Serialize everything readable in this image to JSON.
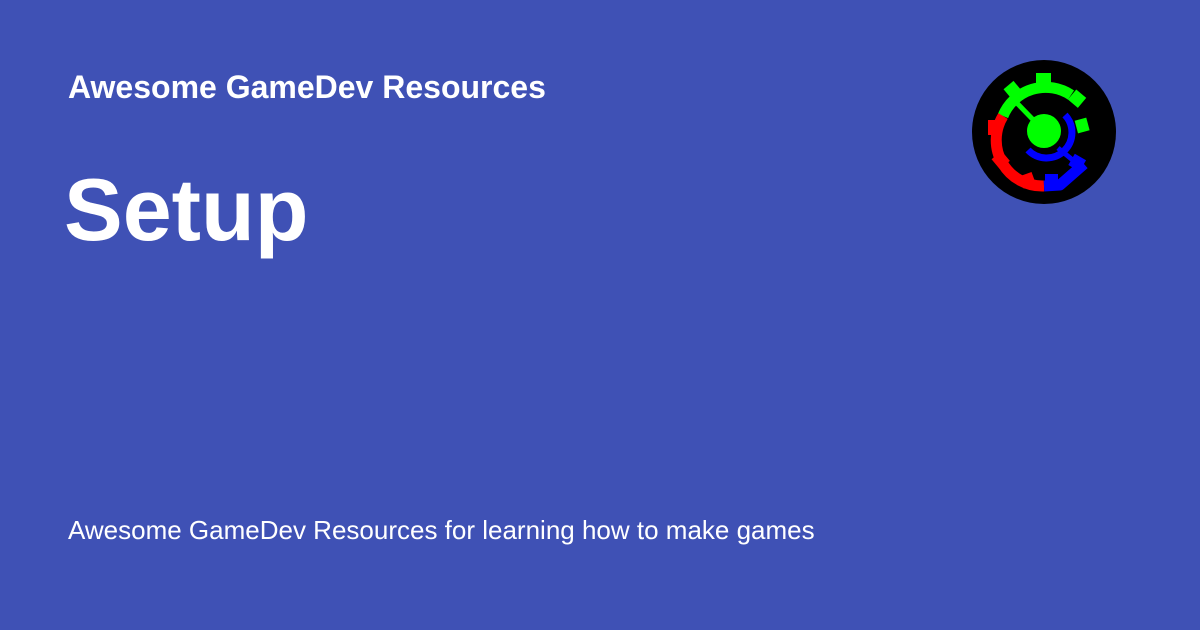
{
  "site": {
    "name": "Awesome GameDev Resources",
    "logo_icon": "gamedev-gear-logo-icon"
  },
  "page": {
    "title": "Setup",
    "description": "Awesome GameDev Resources for learning how to make games"
  },
  "colors": {
    "background": "#3f51b5",
    "text": "#ffffff",
    "logo_background": "#000000",
    "logo_green": "#00ff00",
    "logo_red": "#ff0000",
    "logo_blue": "#0000ff"
  }
}
